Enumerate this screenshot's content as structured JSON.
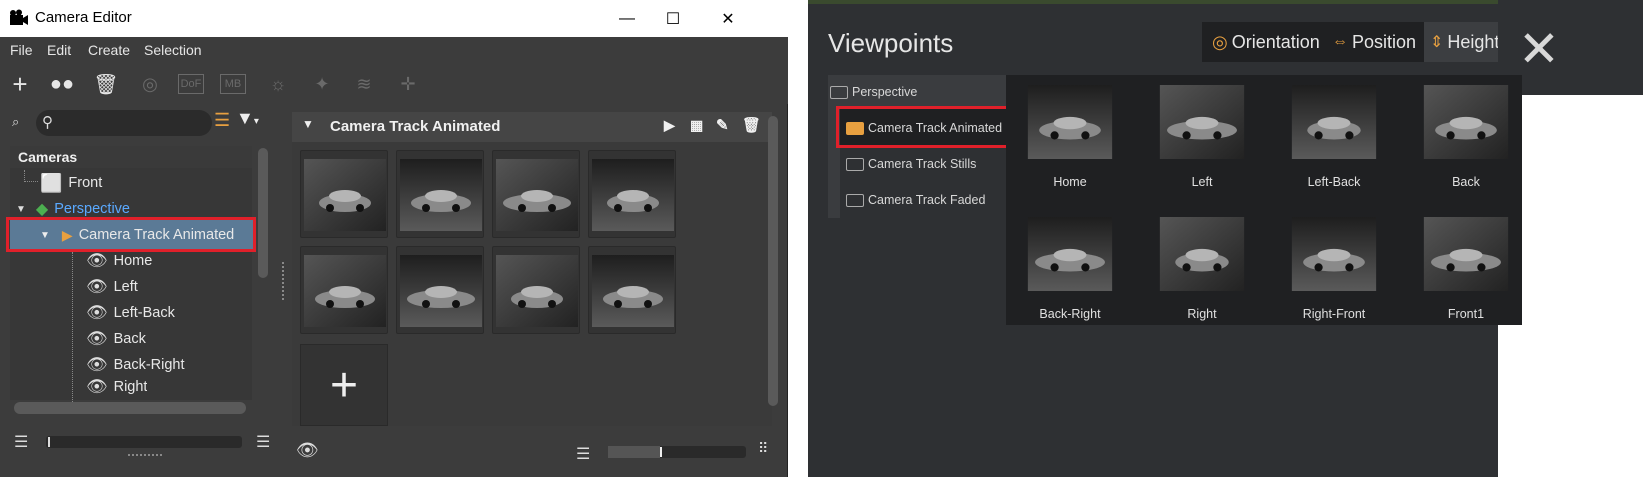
{
  "editor": {
    "title": "Camera Editor",
    "menu": [
      "File",
      "Edit",
      "Create",
      "Selection"
    ],
    "toolbar_dim_labels": [
      "DoF",
      "MB"
    ],
    "tree": {
      "header": "Cameras",
      "front": "Front",
      "perspective": "Perspective",
      "track_animated": "Camera Track Animated",
      "children": [
        "Home",
        "Left",
        "Left-Back",
        "Back",
        "Back-Right",
        "Right"
      ]
    },
    "thumb_panel_title": "Camera Track Animated",
    "add_label": "+"
  },
  "viewpoints": {
    "title": "Viewpoints",
    "tabs": [
      "Orientation",
      "Position",
      "Height"
    ],
    "close_label": "✕",
    "folders": [
      "Perspective",
      "Camera Track Animated",
      "Camera Track Stills",
      "Camera Track Faded"
    ],
    "thumbnails": [
      "Home",
      "Left",
      "Left-Back",
      "Back",
      "Back-Right",
      "Right",
      "Right-Front",
      "Front1"
    ]
  },
  "colors": {
    "selection": "#5b7a96",
    "highlight": "#e0202a",
    "perspective_text": "#5aa9ff",
    "folder": "#e8a040"
  }
}
